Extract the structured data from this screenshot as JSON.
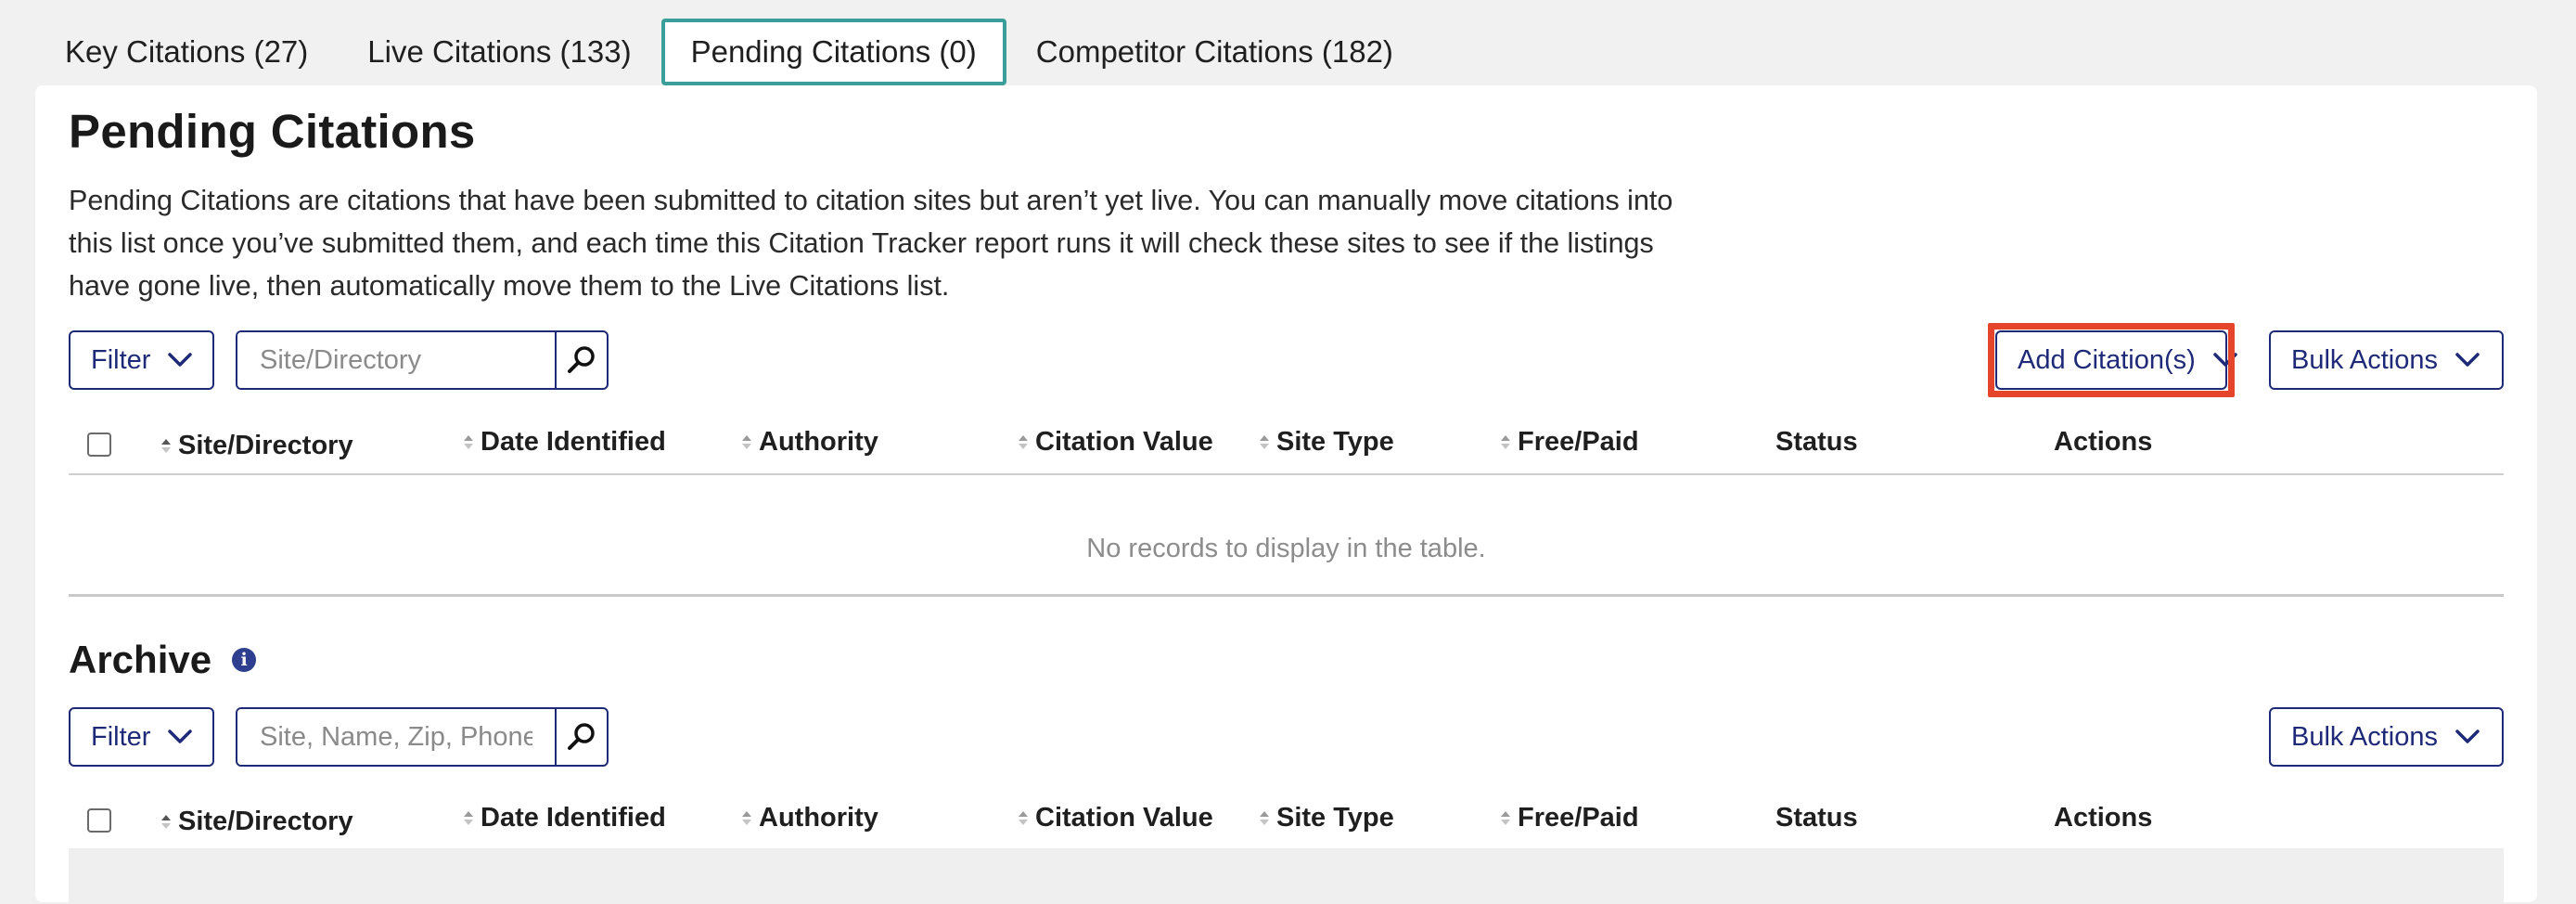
{
  "tabs": [
    {
      "label": "Key Citations (27)",
      "active": false
    },
    {
      "label": "Live Citations (133)",
      "active": false
    },
    {
      "label": "Pending Citations (0)",
      "active": true
    },
    {
      "label": "Competitor Citations (182)",
      "active": false
    }
  ],
  "pending": {
    "title": "Pending Citations",
    "description": "Pending Citations are citations that have been submitted to citation sites but aren’t yet live. You can manually move citations into this list once you’ve submitted them, and each time this Citation Tracker report runs it will check these sites to see if the listings have gone live, then automatically move them to the Live Citations list.",
    "filter_label": "Filter",
    "search_placeholder": "Site/Directory",
    "add_label": "Add Citation(s)",
    "bulk_label": "Bulk Actions",
    "empty_text": "No records to display in the table."
  },
  "columns": [
    "Site/Directory",
    "Date Identified",
    "Authority",
    "Citation Value",
    "Site Type",
    "Free/Paid",
    "Status",
    "Actions"
  ],
  "archive": {
    "title": "Archive",
    "info_icon": "i",
    "filter_label": "Filter",
    "search_placeholder": "Site, Name, Zip, Phone",
    "bulk_label": "Bulk Actions"
  },
  "colors": {
    "accent": "#1e2a78",
    "active_tab": "#3a9e9a",
    "highlight": "#e4452b"
  }
}
